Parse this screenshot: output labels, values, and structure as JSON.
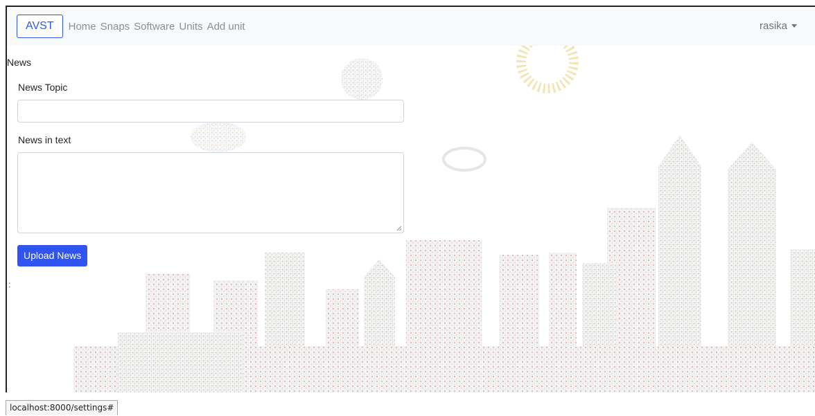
{
  "navbar": {
    "brand": "AVST",
    "links": [
      "Home",
      "Snaps",
      "Software",
      "Units",
      "Add unit"
    ],
    "user": "rasika"
  },
  "page": {
    "section_title": "News",
    "topic_label": "News Topic",
    "topic_value": "",
    "text_label": "News in text",
    "text_value": "",
    "upload_button": "Upload News",
    "stray_mark": ":"
  },
  "statusbar": {
    "url": "localhost:8000/settings#"
  },
  "colors": {
    "accent": "#2f54f0",
    "navbar_bg": "#f8f9fa"
  },
  "icons": {
    "user_dropdown": "caret-down-icon"
  }
}
